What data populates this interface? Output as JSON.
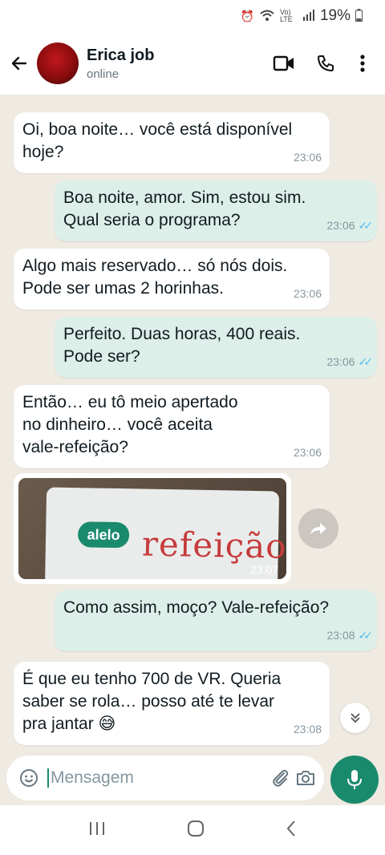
{
  "status_bar": {
    "battery": "19%",
    "network": "Vo) LTE"
  },
  "header": {
    "contact_name": "Erica job",
    "contact_status": "online"
  },
  "messages": [
    {
      "dir": "in",
      "lines": [
        "Oi, boa noite… você está disponível",
        "hoje?"
      ],
      "time": "23:06"
    },
    {
      "dir": "out",
      "lines": [
        "Boa noite, amor. Sim, estou sim.",
        "Qual seria o programa?"
      ],
      "time": "23:06"
    },
    {
      "dir": "in",
      "lines": [
        "Algo mais reservado… só nós dois.",
        "Pode ser umas 2 horinhas."
      ],
      "time": "23:06"
    },
    {
      "dir": "out",
      "lines": [
        "Perfeito. Duas horas, 400 reais.",
        "Pode ser?"
      ],
      "time": "23:06"
    },
    {
      "dir": "in",
      "lines": [
        "Então… eu tô meio apertado",
        "no dinheiro… você aceita",
        "vale-refeição?"
      ],
      "time": "23:06"
    },
    {
      "dir": "out",
      "lines": [
        "Como assim, moço? Vale-refeição?"
      ],
      "time": "23:08"
    },
    {
      "dir": "in",
      "lines": [
        "É que eu tenho 700 de VR. Queria",
        "saber se rola… posso até te levar",
        "pra jantar 😅"
      ],
      "time": "23:08"
    }
  ],
  "media_message": {
    "time": "23:07",
    "card_brand": "alelo",
    "card_word": "refeição"
  },
  "composer": {
    "placeholder": "Mensagem"
  },
  "colors": {
    "accent": "#1a8a6d",
    "chat_bg": "#efeae2",
    "outgoing_bubble": "#dcefe8",
    "read_ticks": "#53bdeb"
  }
}
